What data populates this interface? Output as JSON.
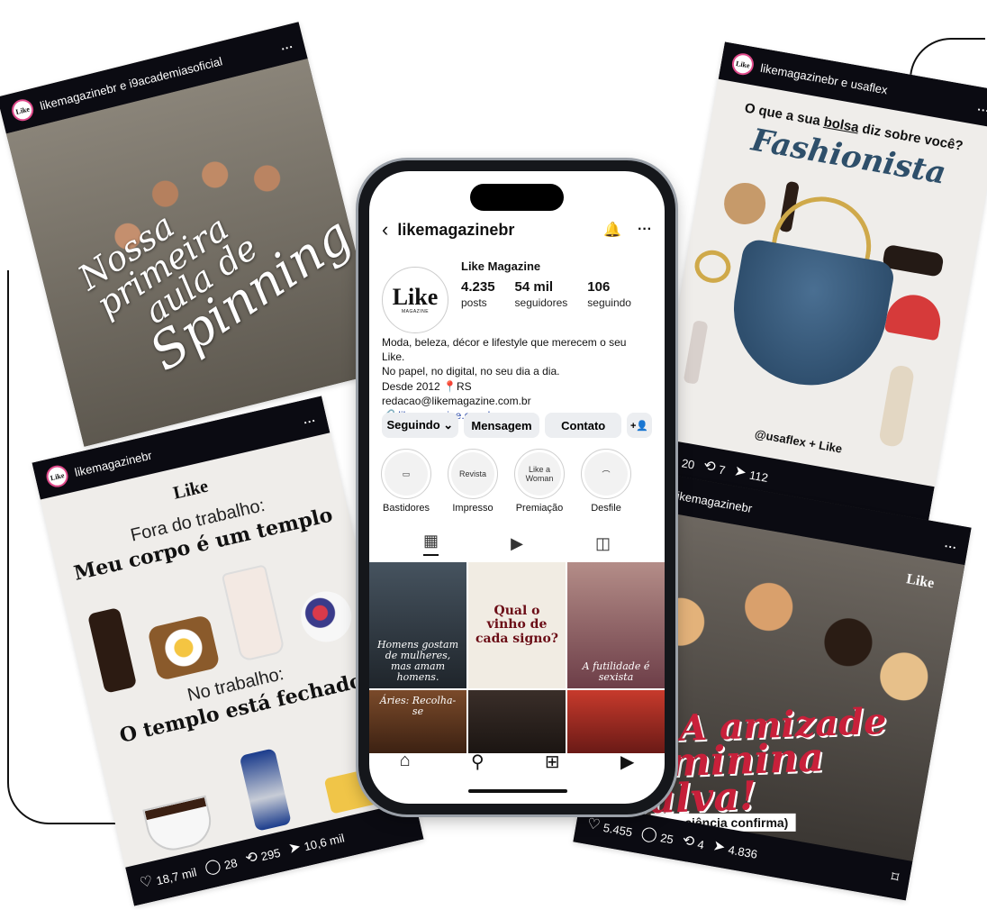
{
  "phone_profile": {
    "username": "likemagazinebr",
    "display_name": "Like Magazine",
    "avatar_text": "Like",
    "avatar_subtext": "MAGAZINE",
    "stats": [
      {
        "value": "4.235",
        "label": "posts"
      },
      {
        "value": "54 mil",
        "label": "seguidores"
      },
      {
        "value": "106",
        "label": "seguindo"
      }
    ],
    "bio_lines": [
      "Moda, beleza, décor e lifestyle que merecem o seu Like.",
      "No papel, no digital, no seu dia a dia.",
      "Desde 2012 📍RS",
      "redacao@likemagazine.com.br"
    ],
    "link": "likemagazine.com.br",
    "buttons": {
      "following": "Seguindo ⌄",
      "message": "Mensagem",
      "contact": "Contato",
      "add_person": "+👤"
    },
    "highlights": [
      {
        "label": "Bastidores",
        "inner": ""
      },
      {
        "label": "Impresso",
        "inner": "Revista"
      },
      {
        "label": "Premiação",
        "inner": "Like a Woman"
      },
      {
        "label": "Desfile",
        "inner": ""
      }
    ],
    "grid_posts": [
      {
        "caption": "Homens gostam de mulheres, mas amam homens."
      },
      {
        "caption": "Qual o vinho de cada signo?"
      },
      {
        "caption": "A futilidade é sexista"
      },
      {
        "caption": "Áries: Recolha-se"
      },
      {
        "caption": ""
      },
      {
        "caption": ""
      }
    ]
  },
  "card_spinning": {
    "header": "likemagazinebr e i9academiasoficial",
    "more": "...",
    "headline": [
      "Nossa primeira",
      "aula de",
      "Spinning"
    ]
  },
  "card_templo": {
    "header": "likemagazinebr",
    "more": "...",
    "logo": "Like",
    "line1_sub": "Fora do trabalho:",
    "line1_head": "Meu corpo é um templo",
    "line2_sub": "No trabalho:",
    "line2_head": "O templo está fechado",
    "likes": "18,7 mil",
    "comments": "28",
    "reposts": "295",
    "shares": "10,6 mil"
  },
  "card_fashion": {
    "header": "likemagazinebr e usaflex",
    "more": "...",
    "question_pre": "O que a sua ",
    "question_word": "bolsa",
    "question_post": " diz sobre você?",
    "title": "Fashionista",
    "footer": "@usaflex + Like",
    "comments": "20",
    "reposts": "7",
    "shares": "112"
  },
  "card_amizade": {
    "header": "likemagazinebr",
    "more": "...",
    "logo": "Like",
    "headline": [
      "A amizade",
      "feminina salva!"
    ],
    "confirm": "(E a ciência confirma)",
    "likes": "5.455",
    "comments": "25",
    "reposts": "4",
    "shares": "4.836"
  },
  "colors": {
    "accent_link": "#2b4aa8",
    "card_bar": "#0b0b12",
    "headline_red": "#c8203a",
    "fashion_blue": "#2e4f6a"
  }
}
